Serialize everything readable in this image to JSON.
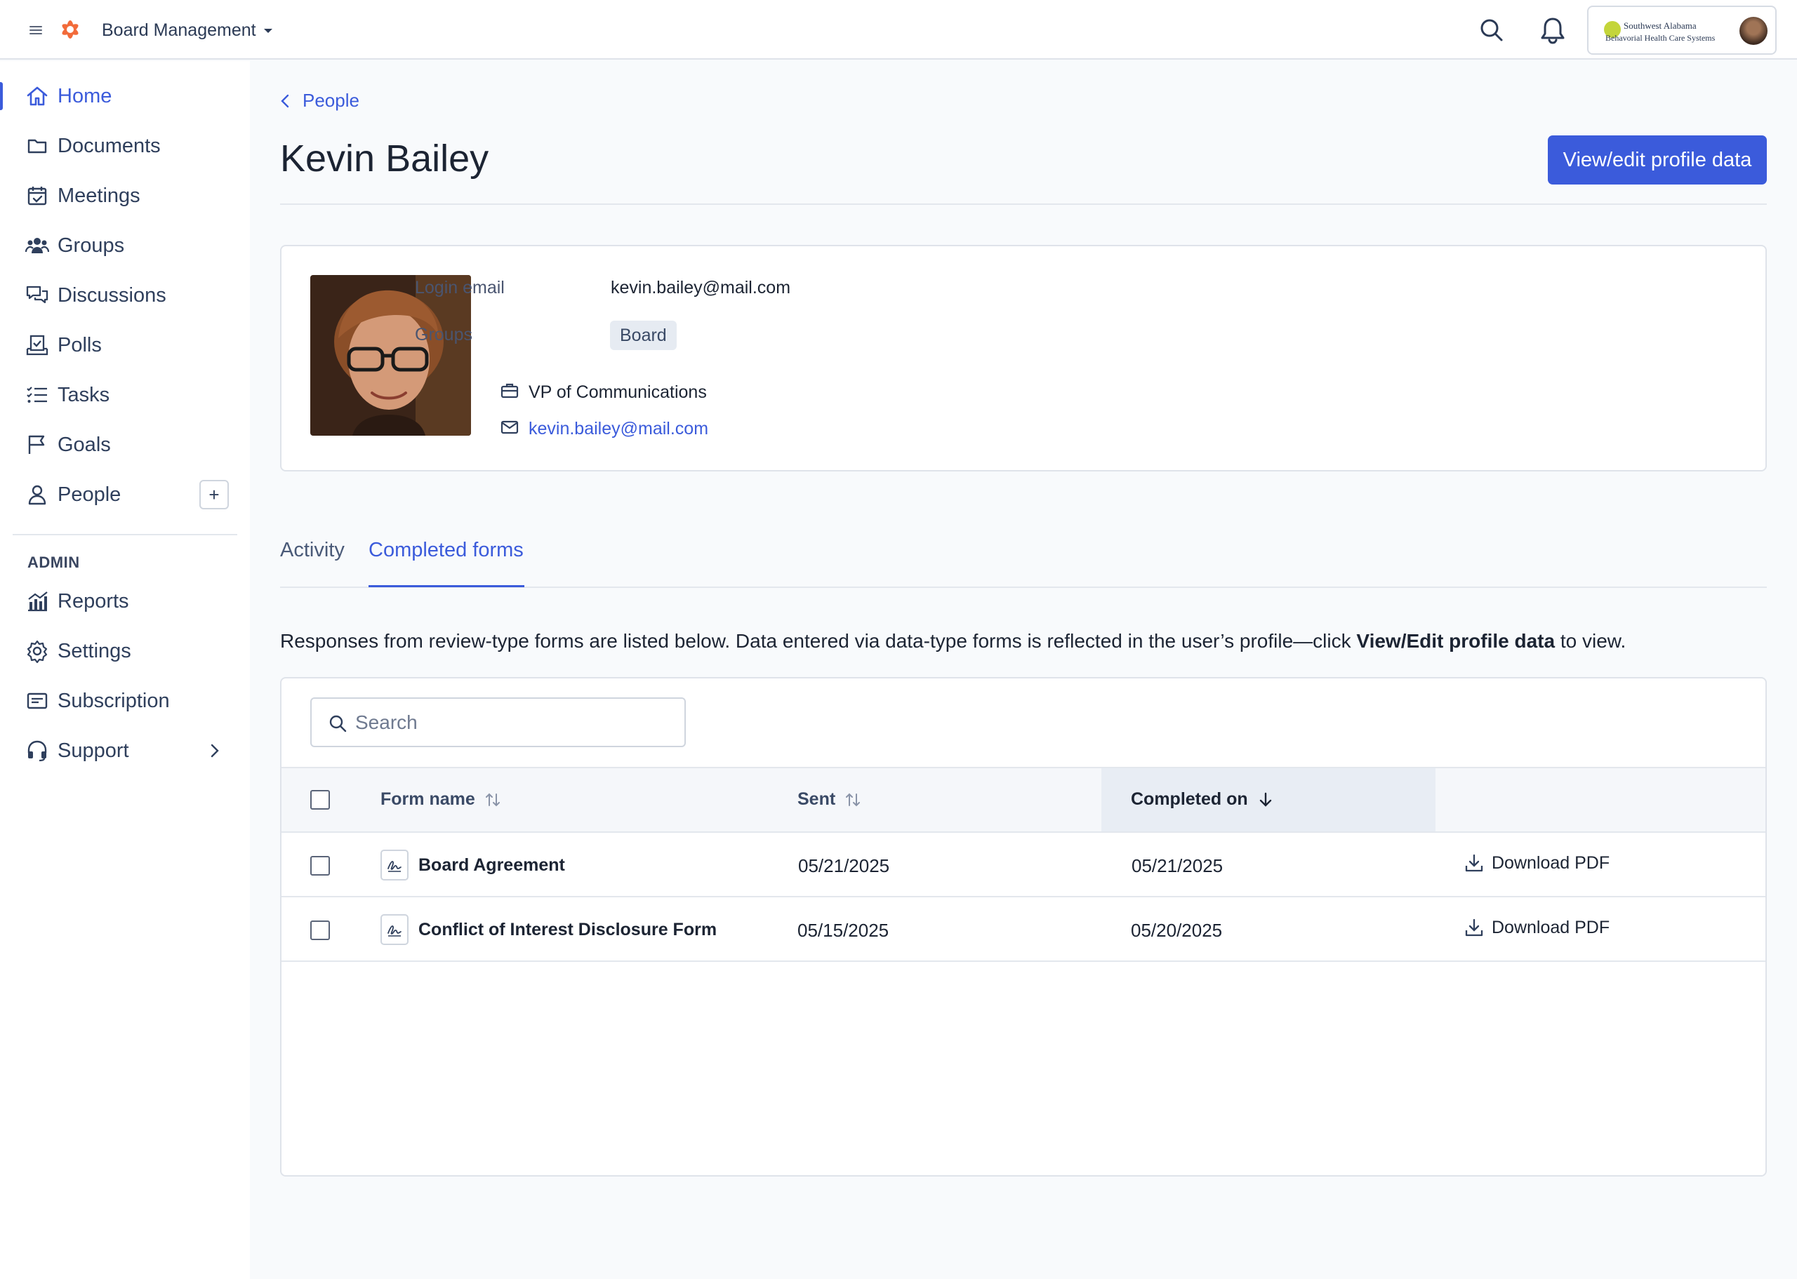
{
  "app": {
    "title": "Board Management",
    "accent": "#3b5bdb",
    "logo_color": "#f26b3a"
  },
  "org": {
    "name_line1": "Southwest Alabama",
    "name_line2": "Behavorial Health Care Systems"
  },
  "sidebar": {
    "items": [
      {
        "label": "Home",
        "icon": "home-icon",
        "active": true
      },
      {
        "label": "Documents",
        "icon": "folder-icon"
      },
      {
        "label": "Meetings",
        "icon": "calendar-check-icon"
      },
      {
        "label": "Groups",
        "icon": "users-icon"
      },
      {
        "label": "Discussions",
        "icon": "chat-bubbles-icon"
      },
      {
        "label": "Polls",
        "icon": "ballot-icon"
      },
      {
        "label": "Tasks",
        "icon": "checklist-icon"
      },
      {
        "label": "Goals",
        "icon": "flag-icon"
      },
      {
        "label": "People",
        "icon": "person-icon"
      }
    ],
    "people_add": "+",
    "admin_label": "ADMIN",
    "admin_items": [
      {
        "label": "Reports",
        "icon": "bar-chart-icon"
      },
      {
        "label": "Settings",
        "icon": "gear-icon"
      },
      {
        "label": "Subscription",
        "icon": "credit-card-icon"
      },
      {
        "label": "Support",
        "icon": "headset-icon"
      }
    ]
  },
  "breadcrumb": {
    "label": "People"
  },
  "profile": {
    "name": "Kevin Bailey",
    "edit_button": "View/edit profile data",
    "login_email_label": "Login email",
    "login_email": "kevin.bailey@mail.com",
    "groups_label": "Groups",
    "groups": [
      "Board"
    ],
    "title": "VP of Communications",
    "email": "kevin.bailey@mail.com"
  },
  "tabs": {
    "activity": "Activity",
    "completed_forms": "Completed forms",
    "active": "completed_forms"
  },
  "info": {
    "text_before": "Responses from review-type forms are listed below. Data entered via data-type forms is reflected in the user’s profile—click ",
    "bold": "View/Edit profile data",
    "text_after": " to view."
  },
  "table": {
    "search_placeholder": "Search",
    "columns": {
      "form_name": "Form name",
      "sent": "Sent",
      "completed_on": "Completed on"
    },
    "sorted_by": "completed_on",
    "rows": [
      {
        "form_name": "Board Agreement",
        "sent": "05/21/2025",
        "completed_on": "05/21/2025",
        "action": "Download PDF"
      },
      {
        "form_name": "Conflict of Interest Disclosure Form",
        "sent": "05/15/2025",
        "completed_on": "05/20/2025",
        "action": "Download PDF"
      }
    ]
  }
}
